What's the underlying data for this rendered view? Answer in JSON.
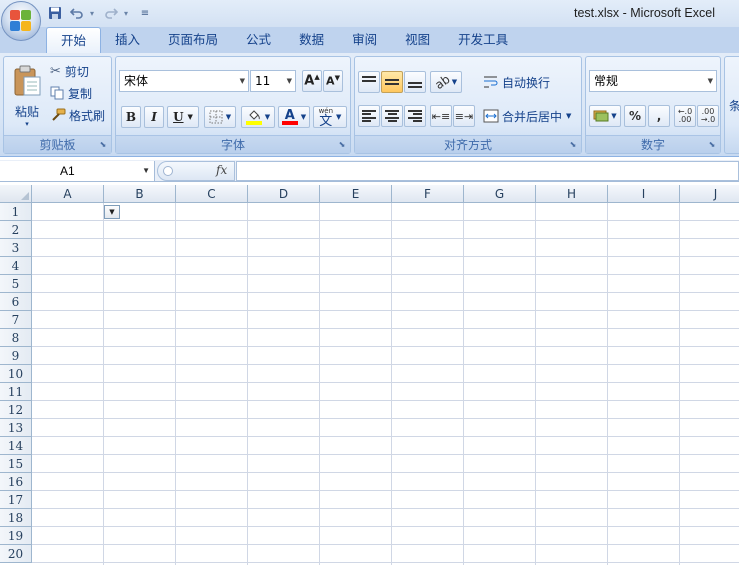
{
  "window": {
    "title": "test.xlsx - Microsoft Excel"
  },
  "quick_access": {
    "icons": [
      "save-icon",
      "undo-icon",
      "redo-icon",
      "customize-icon"
    ]
  },
  "tabs": [
    "开始",
    "插入",
    "页面布局",
    "公式",
    "数据",
    "审阅",
    "视图",
    "开发工具"
  ],
  "ribbon": {
    "clipboard": {
      "label": "剪贴板",
      "paste": "粘贴",
      "cut": "剪切",
      "copy": "复制",
      "format_painter": "格式刷"
    },
    "font": {
      "label": "字体",
      "font_name": "宋体",
      "font_size": "11",
      "bold": "B",
      "italic": "I",
      "underline": "U",
      "fill_color": "#ffff00",
      "font_color": "#ff0000",
      "phonetic": "wén"
    },
    "alignment": {
      "label": "对齐方式",
      "wrap_text": "自动换行",
      "merge_center": "合并后居中"
    },
    "number": {
      "label": "数字",
      "format": "常规",
      "percent": "%",
      "comma": ",",
      "inc_decimal": ".00",
      "dec_decimal": ".00"
    },
    "styles_partial": {
      "label": "条"
    }
  },
  "formula_bar": {
    "name_box": "A1",
    "fx": "fx",
    "formula": ""
  },
  "sheet": {
    "columns": [
      "A",
      "B",
      "C",
      "D",
      "E",
      "F",
      "G",
      "H",
      "I",
      "J"
    ],
    "rows": [
      "1",
      "2",
      "3",
      "4",
      "5",
      "6",
      "7",
      "8",
      "9",
      "10",
      "11",
      "12",
      "13",
      "14",
      "15",
      "16",
      "17",
      "18",
      "19",
      "20"
    ]
  }
}
